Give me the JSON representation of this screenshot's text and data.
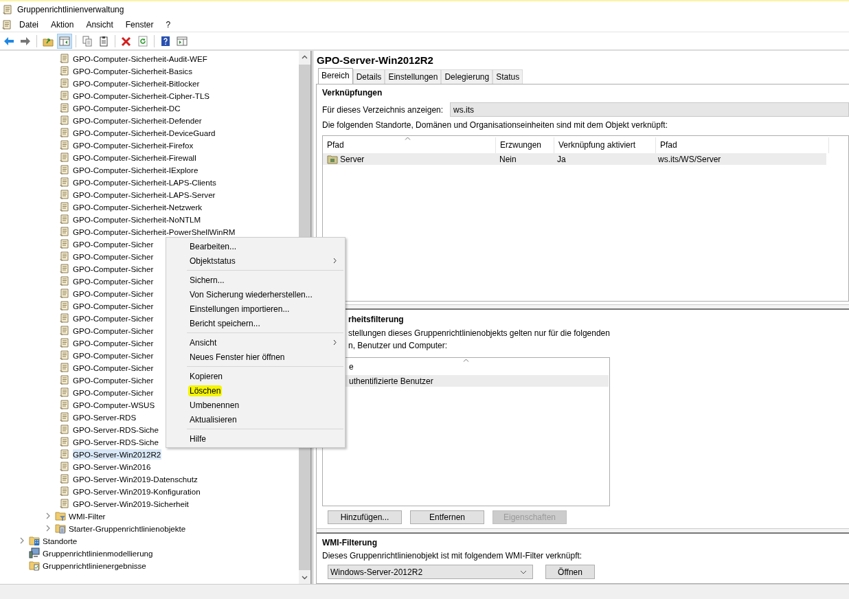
{
  "window": {
    "title": "Gruppenrichtlinienverwaltung"
  },
  "menu_bar": [
    "Datei",
    "Aktion",
    "Ansicht",
    "Fenster",
    "?"
  ],
  "toolbar": [
    {
      "kind": "back",
      "pressed": false
    },
    {
      "kind": "forward",
      "pressed": false
    },
    {
      "kind": "sep"
    },
    {
      "kind": "up",
      "pressed": false
    },
    {
      "kind": "tree",
      "pressed": true
    },
    {
      "kind": "sep"
    },
    {
      "kind": "copy",
      "pressed": false
    },
    {
      "kind": "paste",
      "pressed": false
    },
    {
      "kind": "sep"
    },
    {
      "kind": "delete",
      "pressed": false
    },
    {
      "kind": "refresh",
      "pressed": false
    },
    {
      "kind": "sep"
    },
    {
      "kind": "help",
      "pressed": false
    },
    {
      "kind": "pane",
      "pressed": false
    }
  ],
  "tree": [
    {
      "children": [
        {
          "children": [
            {
              "label": "GPO-Computer-Sicherheit-Audit-WEF",
              "kind": "gpo",
              "selected": false
            },
            {
              "label": "GPO-Computer-Sicherheit-Basics",
              "kind": "gpo",
              "selected": false
            },
            {
              "label": "GPO-Computer-Sicherheit-Bitlocker",
              "kind": "gpo",
              "selected": false
            },
            {
              "label": "GPO-Computer-Sicherheit-Cipher-TLS",
              "kind": "gpo",
              "selected": false
            },
            {
              "label": "GPO-Computer-Sicherheit-DC",
              "kind": "gpo",
              "selected": false
            },
            {
              "label": "GPO-Computer-Sicherheit-Defender",
              "kind": "gpo",
              "selected": false
            },
            {
              "label": "GPO-Computer-Sicherheit-DeviceGuard",
              "kind": "gpo",
              "selected": false
            },
            {
              "label": "GPO-Computer-Sicherheit-Firefox",
              "kind": "gpo",
              "selected": false
            },
            {
              "label": "GPO-Computer-Sicherheit-Firewall",
              "kind": "gpo",
              "selected": false
            },
            {
              "label": "GPO-Computer-Sicherheit-IExplore",
              "kind": "gpo",
              "selected": false
            },
            {
              "label": "GPO-Computer-Sicherheit-LAPS-Clients",
              "kind": "gpo",
              "selected": false
            },
            {
              "label": "GPO-Computer-Sicherheit-LAPS-Server",
              "kind": "gpo",
              "selected": false
            },
            {
              "label": "GPO-Computer-Sicherheit-Netzwerk",
              "kind": "gpo",
              "selected": false
            },
            {
              "label": "GPO-Computer-Sicherheit-NoNTLM",
              "kind": "gpo",
              "selected": false
            },
            {
              "label": "GPO-Computer-Sicherheit-PowerShellWinRM",
              "kind": "gpo",
              "selected": false
            },
            {
              "label": "GPO-Computer-Sicher",
              "kind": "gpo",
              "selected": false
            },
            {
              "label": "GPO-Computer-Sicher",
              "kind": "gpo",
              "selected": false
            },
            {
              "label": "GPO-Computer-Sicher",
              "kind": "gpo",
              "selected": false
            },
            {
              "label": "GPO-Computer-Sicher",
              "kind": "gpo",
              "selected": false
            },
            {
              "label": "GPO-Computer-Sicher",
              "kind": "gpo",
              "selected": false
            },
            {
              "label": "GPO-Computer-Sicher",
              "kind": "gpo",
              "selected": false
            },
            {
              "label": "GPO-Computer-Sicher",
              "kind": "gpo",
              "selected": false
            },
            {
              "label": "GPO-Computer-Sicher",
              "kind": "gpo",
              "selected": false
            },
            {
              "label": "GPO-Computer-Sicher",
              "kind": "gpo",
              "selected": false
            },
            {
              "label": "GPO-Computer-Sicher",
              "kind": "gpo",
              "selected": false
            },
            {
              "label": "GPO-Computer-Sicher",
              "kind": "gpo",
              "selected": false
            },
            {
              "label": "GPO-Computer-Sicher",
              "kind": "gpo",
              "selected": false
            },
            {
              "label": "GPO-Computer-Sicher",
              "kind": "gpo",
              "selected": false
            },
            {
              "label": "GPO-Computer-WSUS",
              "kind": "gpo",
              "selected": false
            },
            {
              "label": "GPO-Server-RDS",
              "kind": "gpo",
              "selected": false
            },
            {
              "label": "GPO-Server-RDS-Siche",
              "kind": "gpo",
              "selected": false
            },
            {
              "label": "GPO-Server-RDS-Siche",
              "kind": "gpo",
              "selected": false
            },
            {
              "label": "GPO-Server-Win2012R2",
              "kind": "gpo",
              "selected": true
            },
            {
              "label": "GPO-Server-Win2016",
              "kind": "gpo",
              "selected": false
            },
            {
              "label": "GPO-Server-Win2019-Datenschutz",
              "kind": "gpo",
              "selected": false
            },
            {
              "label": "GPO-Server-Win2019-Konfiguration",
              "kind": "gpo",
              "selected": false
            },
            {
              "label": "GPO-Server-Win2019-Sicherheit",
              "kind": "gpo",
              "selected": false
            }
          ]
        },
        {
          "label": "WMI-Filter",
          "kind": "filter-folder",
          "selected": false,
          "expanded": false
        },
        {
          "label": "Starter-Gruppenrichtlinienobjekte",
          "kind": "starter-folder",
          "selected": false,
          "expanded": false
        }
      ]
    },
    {
      "label": "Standorte",
      "kind": "sites",
      "selected": false,
      "expanded": false
    },
    {
      "label": "Gruppenrichtlinienmodellierung",
      "kind": "modeling",
      "selected": false
    },
    {
      "label": "Gruppenrichtlinienergebnisse",
      "kind": "results",
      "selected": false
    }
  ],
  "context_menu": {
    "groups": [
      [
        {
          "label": "Bearbeiten...",
          "submenu": false,
          "highlighted": false
        },
        {
          "label": "Objektstatus",
          "submenu": true,
          "highlighted": false
        }
      ],
      [
        {
          "label": "Sichern...",
          "submenu": false,
          "highlighted": false
        },
        {
          "label": "Von Sicherung wiederherstellen...",
          "submenu": false,
          "highlighted": false
        },
        {
          "label": "Einstellungen importieren...",
          "submenu": false,
          "highlighted": false
        },
        {
          "label": "Bericht speichern...",
          "submenu": false,
          "highlighted": false
        }
      ],
      [
        {
          "label": "Ansicht",
          "submenu": true,
          "highlighted": false
        },
        {
          "label": "Neues Fenster hier öffnen",
          "submenu": false,
          "highlighted": false
        }
      ],
      [
        {
          "label": "Kopieren",
          "submenu": false,
          "highlighted": false
        },
        {
          "label": "Löschen",
          "submenu": false,
          "highlighted": true
        },
        {
          "label": "Umbenennen",
          "submenu": false,
          "highlighted": false
        },
        {
          "label": "Aktualisieren",
          "submenu": false,
          "highlighted": false
        }
      ],
      [
        {
          "label": "Hilfe",
          "submenu": false,
          "highlighted": false
        }
      ]
    ]
  },
  "details": {
    "title": "GPO-Server-Win2012R2",
    "tabs": [
      {
        "label": "Bereich",
        "selected": true
      },
      {
        "label": "Details",
        "selected": false
      },
      {
        "label": "Einstellungen",
        "selected": false
      },
      {
        "label": "Delegierung",
        "selected": false
      },
      {
        "label": "Status",
        "selected": false
      }
    ],
    "links": {
      "heading": "Verknüpfungen",
      "show_label": "Für dieses Verzeichnis anzeigen:",
      "show_value": "ws.its",
      "description": "Die folgenden Standorte, Domänen und Organisationseinheiten sind mit dem Objekt verknüpft:",
      "columns": [
        "Pfad",
        "Erzwungen",
        "Verknüpfung aktiviert",
        "Pfad"
      ],
      "rows": [
        {
          "cells": [
            "Server",
            "Nein",
            "Ja",
            "ws.its/WS/Server"
          ],
          "selected": true
        }
      ]
    },
    "security": {
      "heading": "rheitsfilterung",
      "description": [
        "stellungen dieses Gruppenrichtlinienobjekts gelten nur für die folgenden",
        "n, Benutzer und Computer:"
      ],
      "columns": [
        "e"
      ],
      "rows": [
        {
          "cells": [
            "uthentifizierte Benutzer"
          ],
          "selected": true
        }
      ],
      "buttons": [
        {
          "label": "Hinzufügen...",
          "disabled": false
        },
        {
          "label": "Entfernen",
          "disabled": false
        },
        {
          "label": "Eigenschaften",
          "disabled": true
        }
      ]
    },
    "wmi": {
      "heading": "WMI-Filterung",
      "description": "Dieses Gruppenrichtlinienobjekt ist mit folgendem WMI-Filter verknüpft:",
      "value": "Windows-Server-2012R2",
      "button": "Öffnen"
    }
  }
}
